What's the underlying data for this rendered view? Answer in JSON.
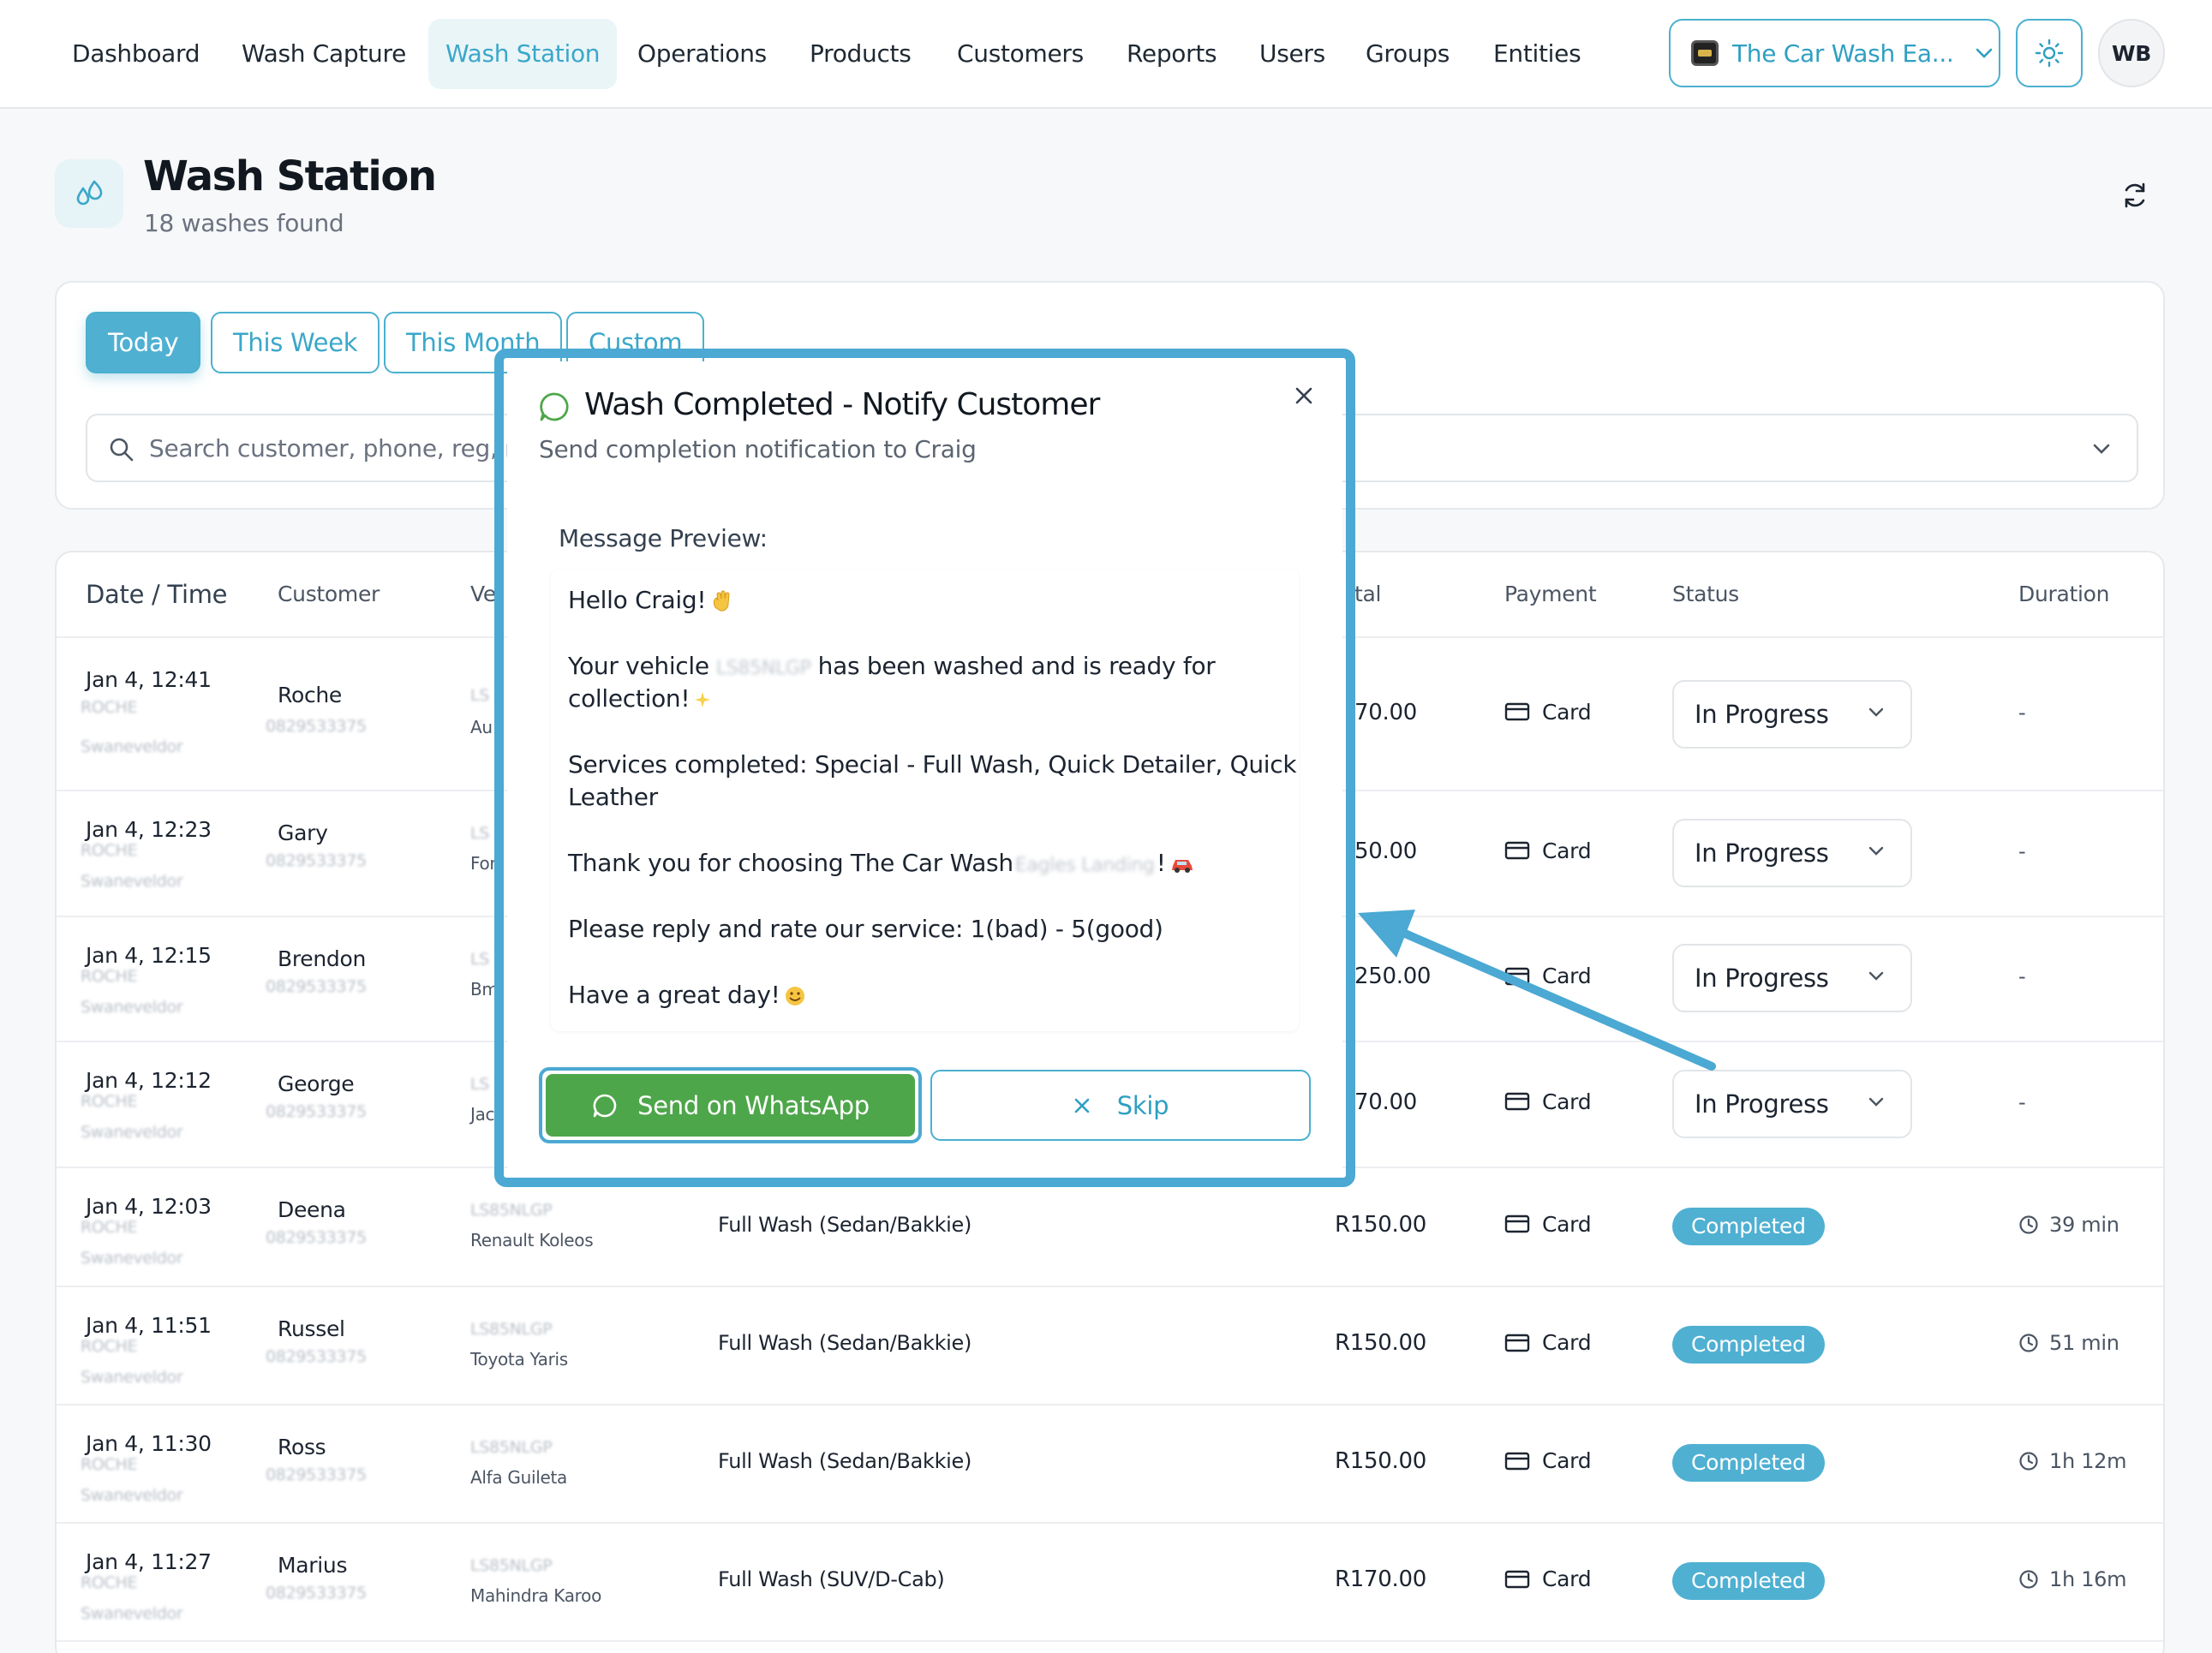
{
  "nav": {
    "items": [
      "Dashboard",
      "Wash Capture",
      "Wash Station",
      "Operations",
      "Products",
      "Customers",
      "Reports",
      "Users",
      "Groups",
      "Entities"
    ],
    "active_index": 2,
    "entity_label": "The Car Wash Ea...",
    "avatar_initials": "WB"
  },
  "header": {
    "title": "Wash Station",
    "subtitle": "18 washes found"
  },
  "filters": {
    "chips": [
      "Today",
      "This Week",
      "This Month",
      "Custom"
    ],
    "active_chip": "Today",
    "search_placeholder": "Search customer, phone, reg, m"
  },
  "table": {
    "columns": [
      "Date / Time",
      "Customer",
      "Ve",
      "tal",
      "Payment",
      "Status",
      "Duration"
    ],
    "rows": [
      {
        "date": "Jan 4, 12:41",
        "customer": "Roche",
        "reg": "LS",
        "model": "Au",
        "service": "",
        "total": "70.00",
        "payment": "Card",
        "status": "In Progress",
        "duration": "-"
      },
      {
        "date": "Jan 4, 12:23",
        "customer": "Gary",
        "reg": "LS",
        "model": "For",
        "service": "",
        "total": "50.00",
        "payment": "Card",
        "status": "In Progress",
        "duration": "-"
      },
      {
        "date": "Jan 4, 12:15",
        "customer": "Brendon",
        "reg": "LS",
        "model": "Bm",
        "service": "",
        "total": "250.00",
        "payment": "Card",
        "status": "In Progress",
        "duration": "-"
      },
      {
        "date": "Jan 4, 12:12",
        "customer": "George",
        "reg": "LS",
        "model": "Jac",
        "service": "",
        "total": "70.00",
        "payment": "Card",
        "status": "In Progress",
        "duration": "-"
      },
      {
        "date": "Jan 4, 12:03",
        "customer": "Deena",
        "reg": "LS85NLGP",
        "model": "Renault Koleos",
        "service": "Full Wash (Sedan/Bakkie)",
        "total": "R150.00",
        "payment": "Card",
        "status": "Completed",
        "duration": "39 min"
      },
      {
        "date": "Jan 4, 11:51",
        "customer": "Russel",
        "reg": "LS85NLGP",
        "model": "Toyota Yaris",
        "service": "Full Wash (Sedan/Bakkie)",
        "total": "R150.00",
        "payment": "Card",
        "status": "Completed",
        "duration": "51 min"
      },
      {
        "date": "Jan 4, 11:30",
        "customer": "Ross",
        "reg": "LS85NLGP",
        "model": "Alfa Guileta",
        "service": "Full Wash (Sedan/Bakkie)",
        "total": "R150.00",
        "payment": "Card",
        "status": "Completed",
        "duration": "1h 12m"
      },
      {
        "date": "Jan 4, 11:27",
        "customer": "Marius",
        "reg": "LS85NLGP",
        "model": "Mahindra Karoo",
        "service": "Full Wash (SUV/D-Cab)",
        "total": "R170.00",
        "payment": "Card",
        "status": "Completed",
        "duration": "1h 16m"
      }
    ],
    "blur_sub": "ROCHE",
    "blur_area": "Swaneveldor",
    "blur_phone": "0829533375"
  },
  "modal": {
    "title": "Wash Completed - Notify Customer",
    "subtitle": "Send completion notification to Craig",
    "preview_label": "Message Preview:",
    "greeting": "Hello Craig!",
    "vehicle_pre": "Your vehicle",
    "vehicle_reg": "LS85NLGP",
    "vehicle_post": "has been washed and is ready for",
    "vehicle_post2": "collection!",
    "services_1": "Services completed: Special - Full Wash, Quick Detailer, Quick",
    "services_2": "Leather",
    "thanks_pre": "Thank you for choosing The Car Wash",
    "thanks_blur": "Eagles Landing",
    "thanks_post": "!",
    "rate": "Please reply and rate our service: 1(bad) - 5(good)",
    "bye": "Have a great day!",
    "send_label": "Send on WhatsApp",
    "skip_label": "Skip"
  },
  "colors": {
    "accent": "#4bb0cf",
    "whatsapp": "#4ea64a",
    "callout": "#4ba9d3"
  }
}
